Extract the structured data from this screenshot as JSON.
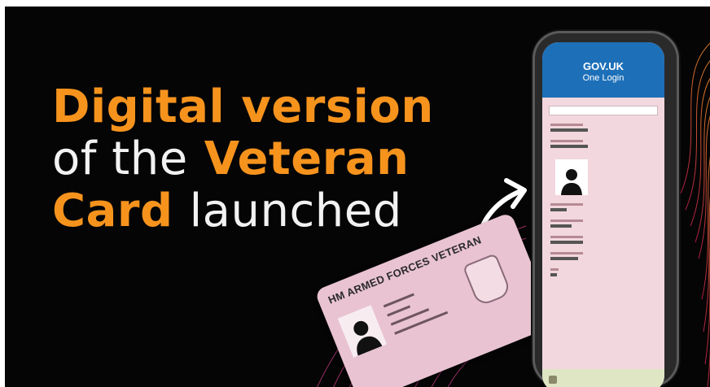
{
  "headline": {
    "line1_orange": "Digital version",
    "line2_white": "of the",
    "line2_orange": "Veteran",
    "line3_orange": "Card",
    "line3_white": "launched"
  },
  "phone": {
    "brand": "GOV.UK",
    "service": "One Login"
  },
  "card": {
    "title": "HM ARMED FORCES VETERAN"
  },
  "colors": {
    "background": "#050505",
    "accent_orange": "#f6931d",
    "gov_blue": "#1d70b8",
    "card_pink": "#e9c3d2"
  },
  "icons": [
    "curved-arrow-icon",
    "person-silhouette-icon",
    "crest-icon"
  ]
}
